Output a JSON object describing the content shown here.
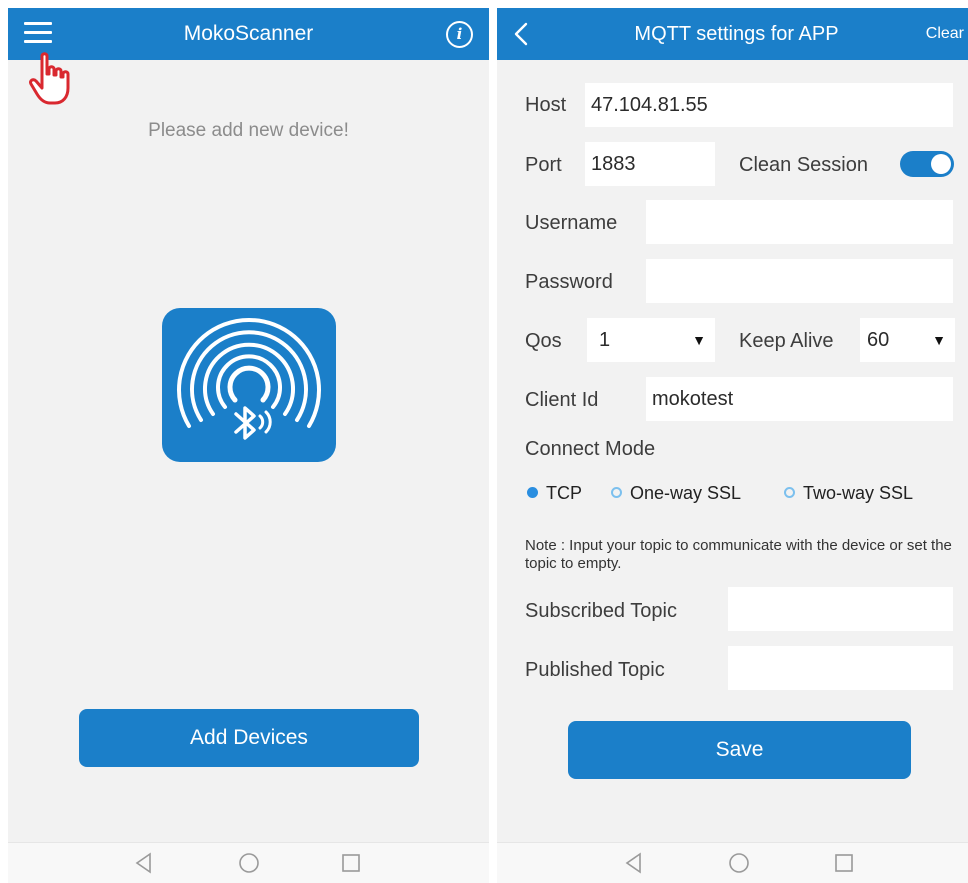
{
  "left_screen": {
    "app_title": "MokoScanner",
    "empty_message": "Please add new device!",
    "add_button_label": "Add Devices"
  },
  "right_screen": {
    "title": "MQTT settings for APP",
    "clear_label": "Clear",
    "host": {
      "label": "Host",
      "value": "47.104.81.55"
    },
    "port": {
      "label": "Port",
      "value": "1883"
    },
    "clean_session": {
      "label": "Clean Session",
      "enabled": true
    },
    "username": {
      "label": "Username",
      "value": ""
    },
    "password": {
      "label": "Password",
      "value": ""
    },
    "qos": {
      "label": "Qos",
      "value": "1"
    },
    "keep_alive": {
      "label": "Keep Alive",
      "value": "60"
    },
    "client_id": {
      "label": "Client Id",
      "value": "mokotest"
    },
    "connect_mode": {
      "label": "Connect Mode",
      "options": [
        "TCP",
        "One-way SSL",
        "Two-way SSL"
      ],
      "selected": "TCP"
    },
    "note": "Note :  Input your topic to communicate with the device or set the topic to empty.",
    "subscribed_topic": {
      "label": "Subscribed Topic",
      "value": ""
    },
    "published_topic": {
      "label": "Published Topic",
      "value": ""
    },
    "save_label": "Save"
  },
  "icons": {
    "menu": "hamburger-menu-icon",
    "pointer": "hand-pointer-icon",
    "info": "info-icon",
    "back": "chevron-left-icon",
    "logo": "bluetooth-scanner-icon",
    "nav": [
      "back-triangle-icon",
      "home-circle-icon",
      "recents-square-icon"
    ]
  },
  "colors": {
    "primary": "#1b7fc9",
    "background": "#f2f2f2",
    "pointer_red": "#d9282f"
  }
}
